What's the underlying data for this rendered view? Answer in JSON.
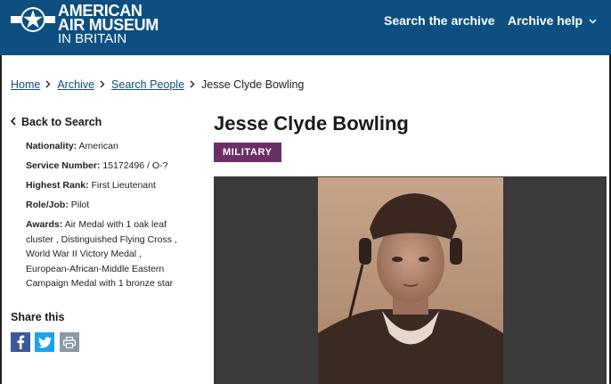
{
  "header": {
    "logo": {
      "line1": "AMERICAN",
      "line2": "AIR MUSEUM",
      "line3": "IN BRITAIN"
    },
    "nav": {
      "search_label": "Search the archive",
      "help_label": "Archive help"
    }
  },
  "breadcrumb": {
    "items": [
      "Home",
      "Archive",
      "Search People"
    ],
    "current": "Jesse Clyde Bowling"
  },
  "sidebar": {
    "back_label": "Back to Search",
    "fields": [
      {
        "label": "Nationality:",
        "value": "American"
      },
      {
        "label": "Service Number:",
        "value": "15172496 / O-?"
      },
      {
        "label": "Highest Rank:",
        "value": "First Lieutenant"
      },
      {
        "label": "Role/Job:",
        "value": "Pilot"
      },
      {
        "label": "Awards:",
        "value": "Air Medal with 1 oak leaf cluster , Distinguished Flying Cross , World War II Victory Medal , European-African-Middle Eastern Campaign Medal with 1 bronze star"
      }
    ],
    "share_title": "Share this"
  },
  "main": {
    "title": "Jesse Clyde Bowling",
    "badge": "MILITARY"
  },
  "colors": {
    "header_bg": "#0d4f80",
    "badge_bg": "#6b2f68",
    "link": "#0d4f80",
    "facebook": "#3b5998",
    "twitter": "#1da1f2",
    "print": "#8a9aa3"
  }
}
